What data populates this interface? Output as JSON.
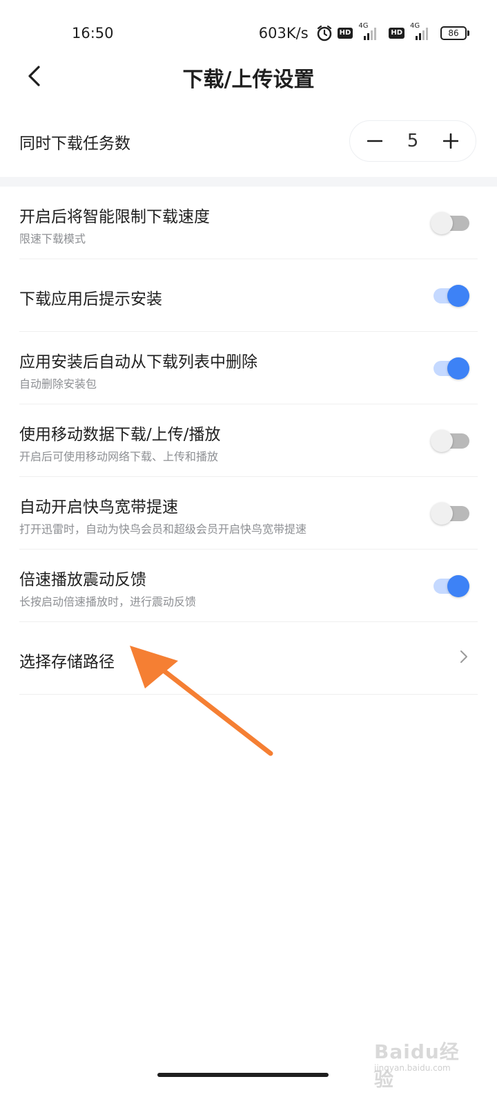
{
  "status_bar": {
    "time": "16:50",
    "net_speed": "603K/s",
    "hd_label": "HD",
    "network_type": "4G",
    "battery": "86"
  },
  "header": {
    "title": "下载/上传设置"
  },
  "concurrent_downloads": {
    "label": "同时下载任务数",
    "value": "5"
  },
  "settings": [
    {
      "title": "开启后将智能限制下载速度",
      "subtitle": "限速下载模式",
      "enabled": false
    },
    {
      "title": "下载应用后提示安装",
      "subtitle": "",
      "enabled": true
    },
    {
      "title": "应用安装后自动从下载列表中删除",
      "subtitle": "自动删除安装包",
      "enabled": true
    },
    {
      "title": "使用移动数据下载/上传/播放",
      "subtitle": "开启后可使用移动网络下载、上传和播放",
      "enabled": false
    },
    {
      "title": "自动开启快鸟宽带提速",
      "subtitle": "打开迅雷时，自动为快鸟会员和超级会员开启快鸟宽带提速",
      "enabled": false
    },
    {
      "title": "倍速播放震动反馈",
      "subtitle": "长按启动倍速播放时，进行震动反馈",
      "enabled": true
    }
  ],
  "storage_path": {
    "label": "选择存储路径"
  },
  "watermark": {
    "text": "Baidu经验",
    "sub": "jingyan.baidu.com"
  },
  "colors": {
    "toggle_on": "#3d82f6",
    "toggle_on_track": "#c5d9ff",
    "toggle_off_track": "#b9b9b9",
    "annotation_arrow": "#f57f33"
  }
}
